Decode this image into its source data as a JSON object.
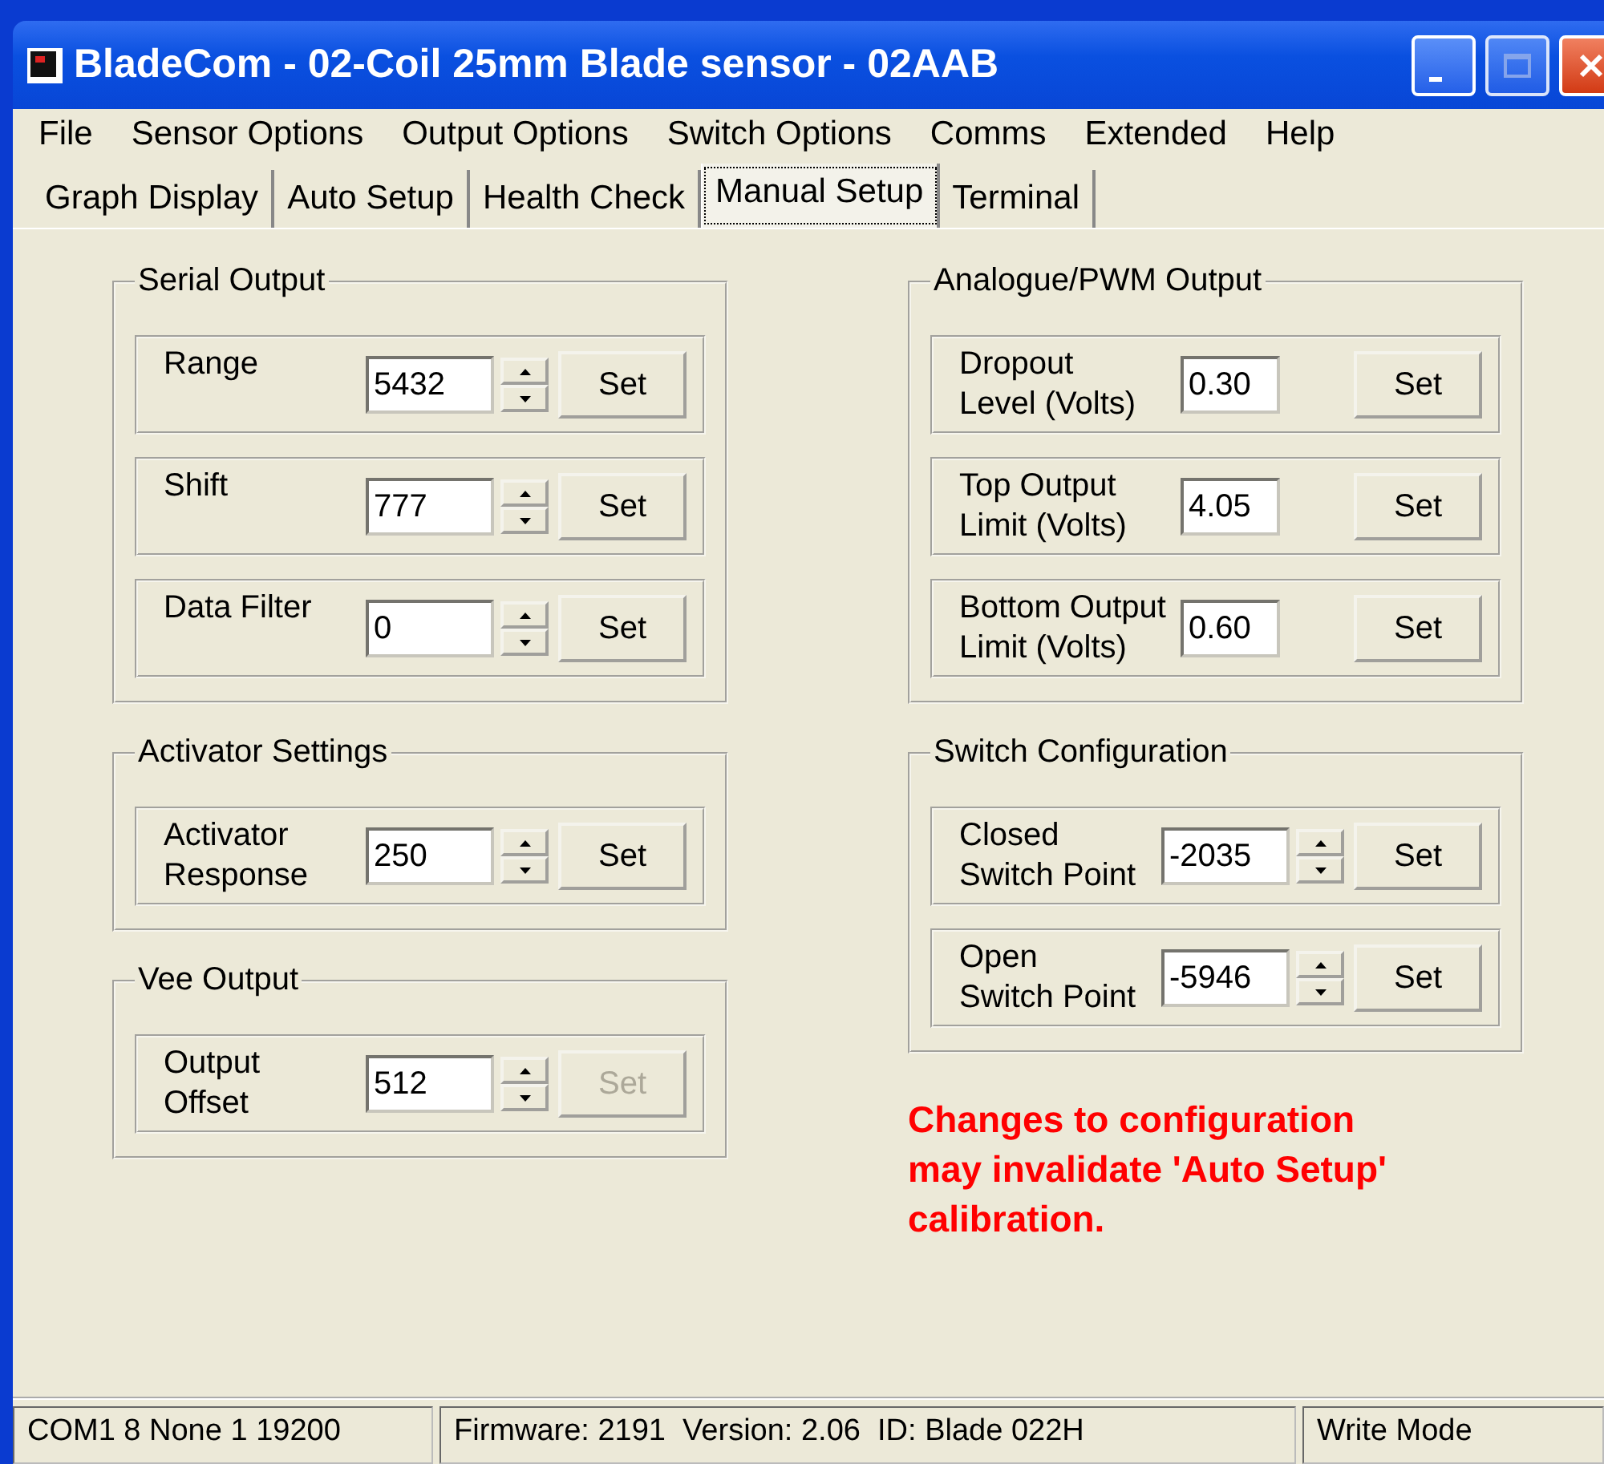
{
  "window": {
    "title": "BladeCom - 02-Coil 25mm Blade sensor - 02AAB"
  },
  "menu": [
    "File",
    "Sensor Options",
    "Output Options",
    "Switch Options",
    "Comms",
    "Extended",
    "Help"
  ],
  "tabs": [
    {
      "label": "Graph Display",
      "selected": false
    },
    {
      "label": "Auto Setup",
      "selected": false
    },
    {
      "label": "Health Check",
      "selected": false
    },
    {
      "label": "Manual Setup",
      "selected": true
    },
    {
      "label": "Terminal",
      "selected": false
    }
  ],
  "columns": [
    {
      "groups": [
        {
          "title": "Serial Output",
          "rows": [
            {
              "label": [
                "Range"
              ],
              "value": "5432",
              "kind": "spin",
              "button": {
                "label": "Set",
                "disabled": false
              }
            },
            {
              "label": [
                "Shift"
              ],
              "value": "777",
              "kind": "spin",
              "button": {
                "label": "Set",
                "disabled": false
              }
            },
            {
              "label": [
                "Data Filter"
              ],
              "value": "0",
              "kind": "spin",
              "button": {
                "label": "Set",
                "disabled": false
              }
            }
          ]
        },
        {
          "title": "Activator Settings",
          "rows": [
            {
              "label": [
                "Activator",
                "Response"
              ],
              "value": "250",
              "kind": "spin",
              "button": {
                "label": "Set",
                "disabled": false
              }
            }
          ]
        },
        {
          "title": "Vee Output",
          "rows": [
            {
              "label": [
                "Output",
                "Offset"
              ],
              "value": "512",
              "kind": "spin",
              "button": {
                "label": "Set",
                "disabled": true
              }
            }
          ]
        }
      ]
    },
    {
      "groups": [
        {
          "title": "Analogue/PWM Output",
          "rows": [
            {
              "label": [
                "Dropout",
                "Level (Volts)"
              ],
              "value": "0.30",
              "kind": "plain",
              "button": {
                "label": "Set",
                "disabled": false
              }
            },
            {
              "label": [
                "Top Output",
                "Limit (Volts)"
              ],
              "value": "4.05",
              "kind": "plain",
              "button": {
                "label": "Set",
                "disabled": false
              }
            },
            {
              "label": [
                "Bottom Output",
                "Limit (Volts)"
              ],
              "value": "0.60",
              "kind": "plain",
              "button": {
                "label": "Set",
                "disabled": false
              }
            }
          ]
        },
        {
          "title": "Switch Configuration",
          "rows": [
            {
              "label": [
                "Closed",
                "Switch Point"
              ],
              "value": "-2035",
              "kind": "spin",
              "button": {
                "label": "Set",
                "disabled": false
              }
            },
            {
              "label": [
                "Open",
                "Switch Point"
              ],
              "value": "-5946",
              "kind": "spin",
              "button": {
                "label": "Set",
                "disabled": false
              }
            }
          ]
        }
      ],
      "warning": [
        "Changes to configuration",
        "may invalidate 'Auto Setup'",
        "calibration."
      ]
    }
  ],
  "status_bar": [
    "COM1 8 None 1 19200",
    "Firmware: 2191  Version: 2.06  ID: Blade 022H",
    "Write Mode"
  ]
}
